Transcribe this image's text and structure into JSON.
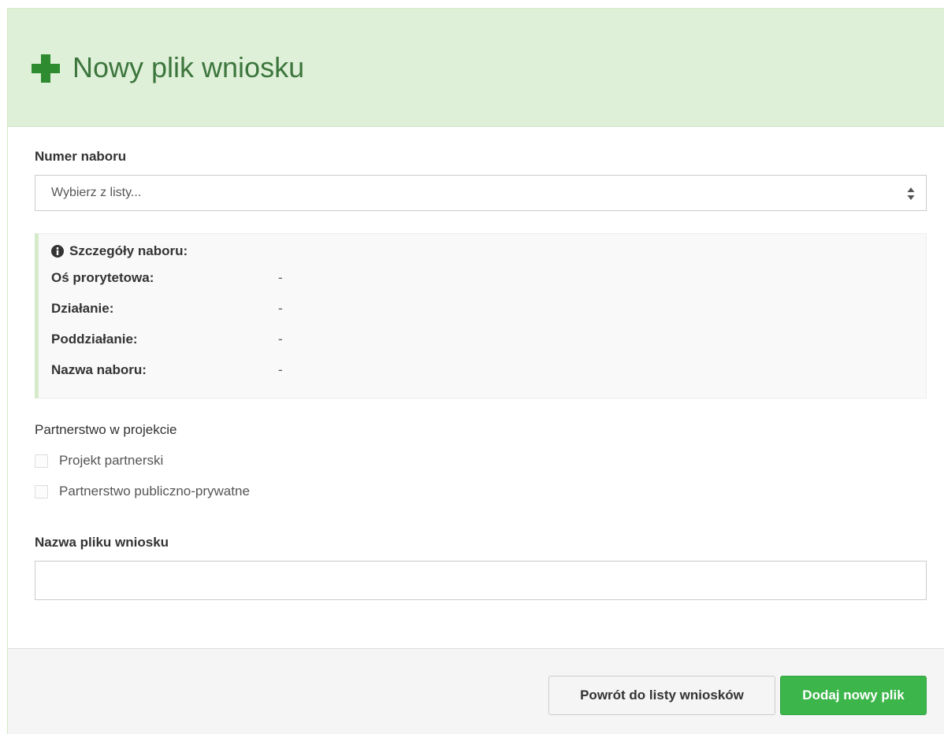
{
  "header": {
    "title": "Nowy plik wniosku",
    "icon": "plus-icon",
    "icon_color": "#2f8b2f"
  },
  "nabor": {
    "label": "Numer naboru",
    "select_value": "Wybierz z listy..."
  },
  "details": {
    "title": "Szczegóły naboru:",
    "rows": [
      {
        "label": "Oś prorytetowa:",
        "value": "-"
      },
      {
        "label": "Działanie:",
        "value": "-"
      },
      {
        "label": "Poddziałanie:",
        "value": "-"
      },
      {
        "label": "Nazwa naboru:",
        "value": "-"
      }
    ]
  },
  "partnership": {
    "label": "Partnerstwo w projekcie",
    "options": [
      {
        "label": "Projekt partnerski",
        "checked": false
      },
      {
        "label": "Partnerstwo publiczno-prywatne",
        "checked": false
      }
    ]
  },
  "file_name": {
    "label": "Nazwa pliku wniosku",
    "value": ""
  },
  "footer": {
    "back_label": "Powrót do listy wniosków",
    "add_label": "Dodaj nowy plik"
  }
}
